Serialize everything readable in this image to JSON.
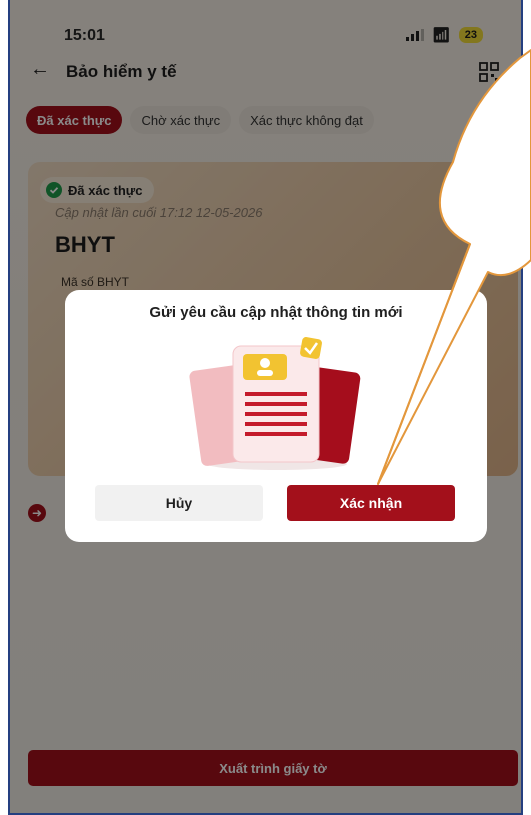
{
  "status_bar": {
    "time": "15:01",
    "battery": "23",
    "wifi_icon": "wifi-icon",
    "signal_icon": "signal-icon"
  },
  "header": {
    "back_icon": "back-arrow-icon",
    "title": "Bảo hiểm y tế",
    "qr_icon": "qr-code-icon"
  },
  "tabs": [
    {
      "label": "Đã xác thực",
      "active": true
    },
    {
      "label": "Chờ xác thực",
      "active": false
    },
    {
      "label": "Xác thực không đạt",
      "active": false
    }
  ],
  "card": {
    "badge": "Đã xác thực",
    "updated": "Cập nhật lần cuối 17:12 12-05-2026",
    "title": "BHYT",
    "field_label": "Mã số BHYT"
  },
  "present_button": "Xuất trình giấy tờ",
  "dialog": {
    "title": "Gửi yêu cầu cập nhật thông tin mới",
    "cancel": "Hủy",
    "confirm": "Xác nhận"
  },
  "colors": {
    "accent": "#a3101b",
    "callout_stroke": "#e3973c",
    "frame_border": "#243f80"
  }
}
